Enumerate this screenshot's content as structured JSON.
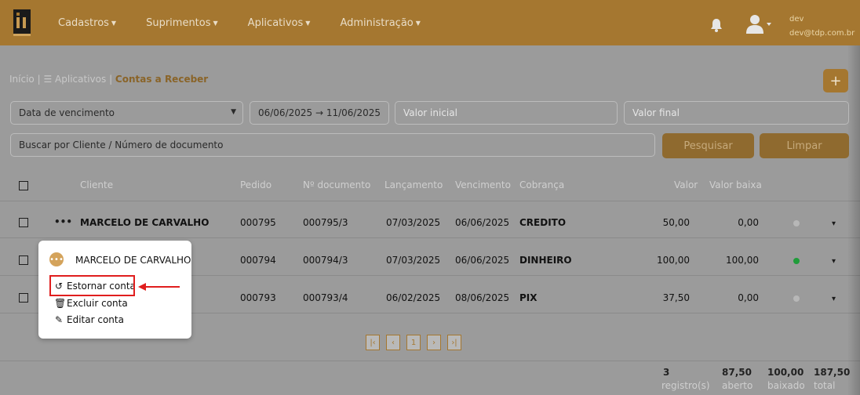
{
  "topbar": {
    "menu": [
      {
        "label": "Cadastros"
      },
      {
        "label": "Suprimentos"
      },
      {
        "label": "Aplicativos"
      },
      {
        "label": "Administração"
      }
    ],
    "user_name": "dev",
    "user_email": "dev@tdp.com.br"
  },
  "breadcrumb": {
    "home": "Início",
    "apps": "Aplicativos",
    "current": "Contas a Receber"
  },
  "filters": {
    "date_type": "Data de vencimento",
    "date_range": "06/06/2025 → 11/06/2025",
    "valor_inicial_placeholder": "Valor inicial",
    "valor_final_placeholder": "Valor final",
    "search_placeholder": "Buscar por Cliente / Número de documento",
    "search_button": "Pesquisar",
    "clear_button": "Limpar"
  },
  "table": {
    "headers": {
      "cliente": "Cliente",
      "pedido": "Pedido",
      "documento": "Nº documento",
      "lancamento": "Lançamento",
      "vencimento": "Vencimento",
      "cobranca": "Cobrança",
      "valor": "Valor",
      "valor_baixa": "Valor baixa"
    },
    "rows": [
      {
        "cliente": "MARCELO DE CARVALHO",
        "pedido": "000795",
        "documento": "000795/3",
        "lancamento": "07/03/2025",
        "vencimento": "06/06/2025",
        "cobranca": "CREDITO",
        "valor": "50,00",
        "valor_baixa": "0,00",
        "status_color": "#b7b7b7"
      },
      {
        "cliente": "MARCELO DE CARVALHO",
        "pedido": "000794",
        "documento": "000794/3",
        "lancamento": "07/03/2025",
        "vencimento": "06/06/2025",
        "cobranca": "DINHEIRO",
        "valor": "100,00",
        "valor_baixa": "100,00",
        "status_color": "#1f9c3a"
      },
      {
        "cliente": "MARCELO DE CARVALHO",
        "pedido": "000793",
        "documento": "000793/4",
        "lancamento": "06/02/2025",
        "vencimento": "08/06/2025",
        "cobranca": "PIX",
        "valor": "37,50",
        "valor_baixa": "0,00",
        "status_color": "#b7b7b7"
      }
    ]
  },
  "pagination": {
    "current_page": "1"
  },
  "footer": {
    "registros": "3",
    "registros_label": "registro(s)",
    "aberto": "87,50",
    "aberto_label": "aberto",
    "baixado": "100,00",
    "baixado_label": "baixado",
    "total": "187,50",
    "total_label": "total"
  },
  "popup": {
    "title": "MARCELO DE CARVALHO",
    "items": [
      {
        "label": "Estornar conta",
        "icon": "undo-icon"
      },
      {
        "label": "Excluir conta",
        "icon": "trash-icon"
      },
      {
        "label": "Editar conta",
        "icon": "pencil-icon"
      }
    ]
  },
  "colors": {
    "brand": "#a57730",
    "highlight": "#e01e1e",
    "status_paid": "#1f9c3a",
    "status_open": "#b7b7b7"
  }
}
